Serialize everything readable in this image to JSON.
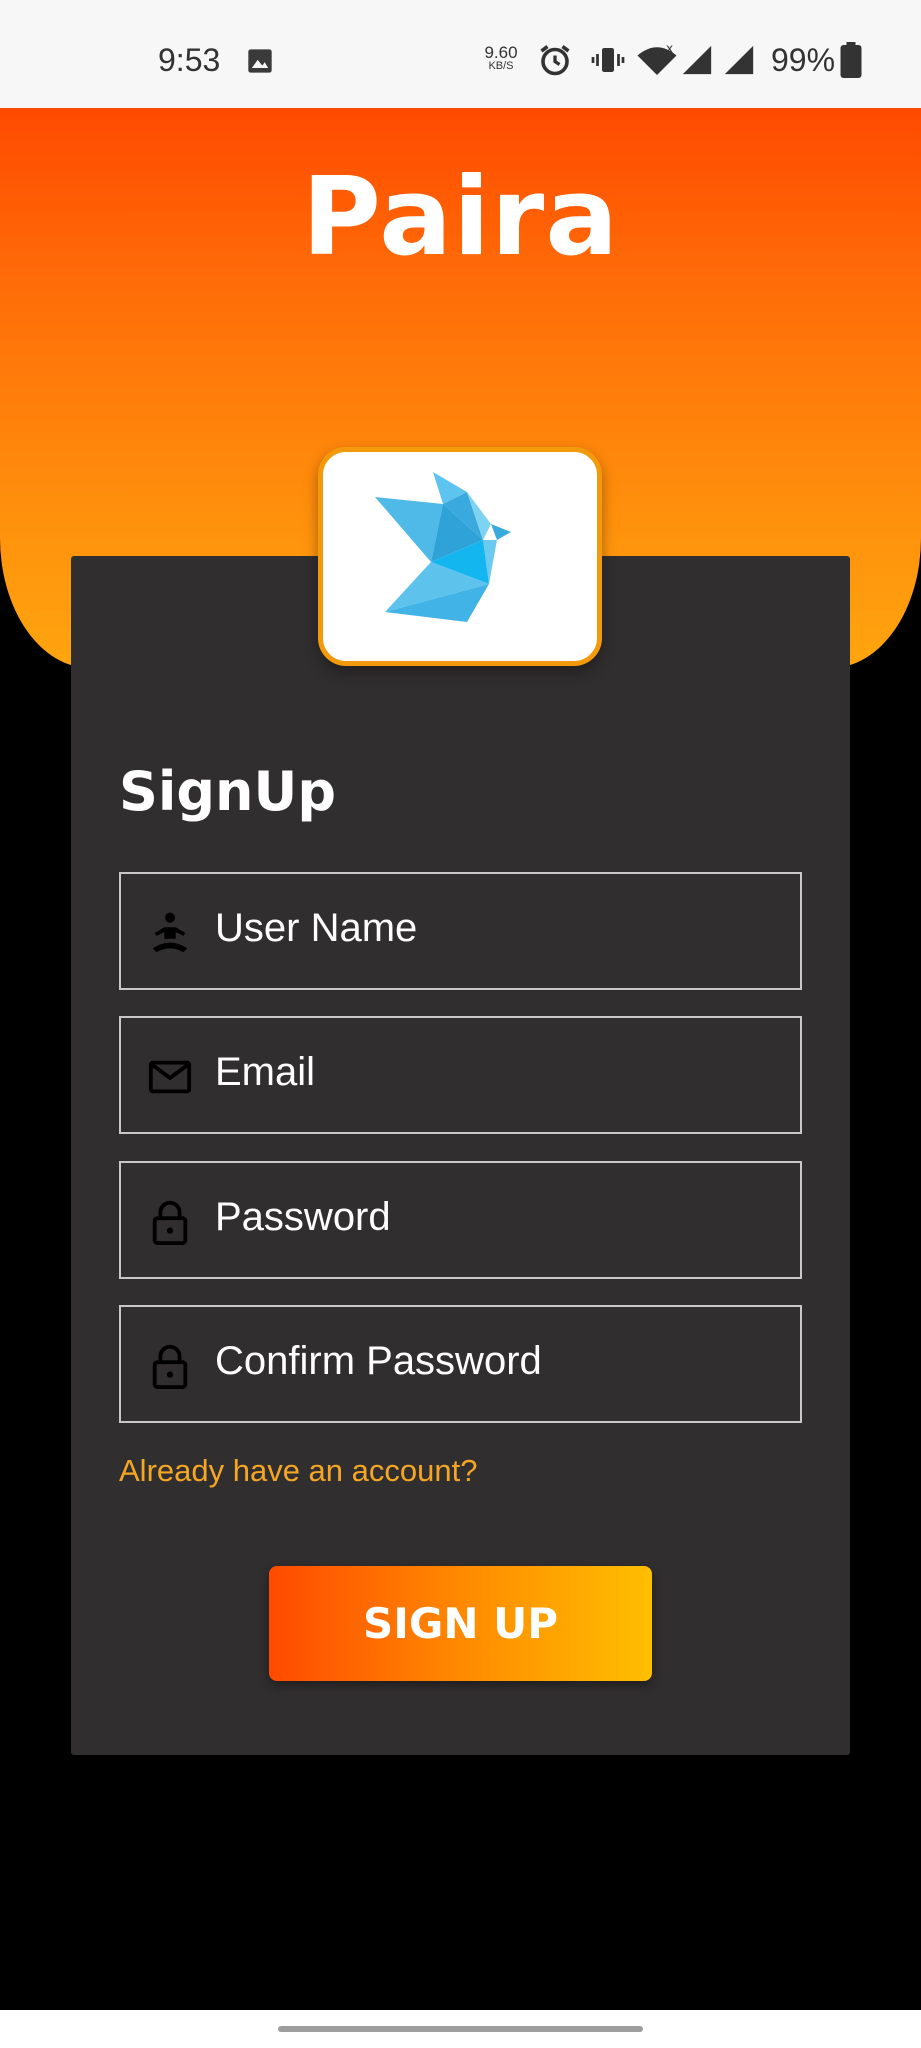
{
  "status_bar": {
    "time": "9:53",
    "net_speed_value": "9.60",
    "net_speed_unit": "KB/S",
    "battery_percent": "99%",
    "icons": [
      "gallery-icon",
      "alarm-icon",
      "vibrate-icon",
      "wifi-icon",
      "signal-icon",
      "signal-icon",
      "battery-icon"
    ]
  },
  "header": {
    "app_title": "Paira",
    "logo": "origami-bird-logo"
  },
  "form": {
    "title": "SignUp",
    "fields": [
      {
        "label": "User Name",
        "icon": "person-icon"
      },
      {
        "label": "Email",
        "icon": "mail-icon"
      },
      {
        "label": "Password",
        "icon": "lock-icon"
      },
      {
        "label": "Confirm Password",
        "icon": "lock-icon"
      }
    ],
    "login_link": "Already have an account?",
    "submit_label": "SIGN UP"
  },
  "colors": {
    "accent": "#ff4a00",
    "accent_end": "#ffbf00",
    "link": "#f5a623",
    "card": "#312e2f",
    "background": "#000000"
  }
}
